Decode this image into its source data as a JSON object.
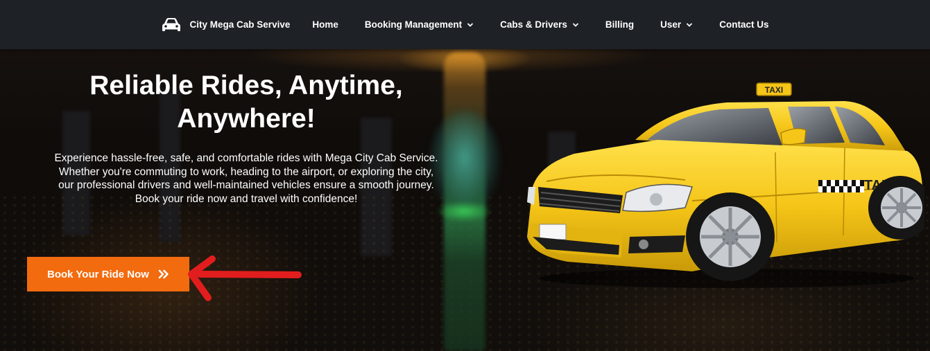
{
  "nav": {
    "brand": "City Mega Cab Servive",
    "items": [
      {
        "label": "Home",
        "dropdown": false
      },
      {
        "label": "Booking Management",
        "dropdown": true
      },
      {
        "label": "Cabs & Drivers",
        "dropdown": true
      },
      {
        "label": "Billing",
        "dropdown": false
      },
      {
        "label": "User",
        "dropdown": true
      },
      {
        "label": "Contact Us",
        "dropdown": false
      }
    ]
  },
  "hero": {
    "title_line1": "Reliable Rides, Anytime,",
    "title_line2": "Anywhere!",
    "description": [
      "Experience hassle-free, safe, and comfortable rides with Mega City Cab Service.",
      "Whether you're commuting to work, heading to the airport, or exploring the city,",
      "our professional drivers and well-maintained vehicles ensure a smooth journey.",
      "Book your ride now and travel with confidence!"
    ],
    "cta_label": "Book Your Ride Now",
    "taxi_sign": "TAXI",
    "taxi_door_text": "TAXI"
  },
  "icons": {
    "brand": "car-icon",
    "dropdown": "chevron-down-icon",
    "cta": "double-chevron-right-icon",
    "annotation": "red-arrow-icon"
  },
  "colors": {
    "navbar": "#1e2126",
    "cta": "#f26b0f",
    "annotation_arrow": "#e11d1d",
    "taxi": "#f5c518"
  }
}
